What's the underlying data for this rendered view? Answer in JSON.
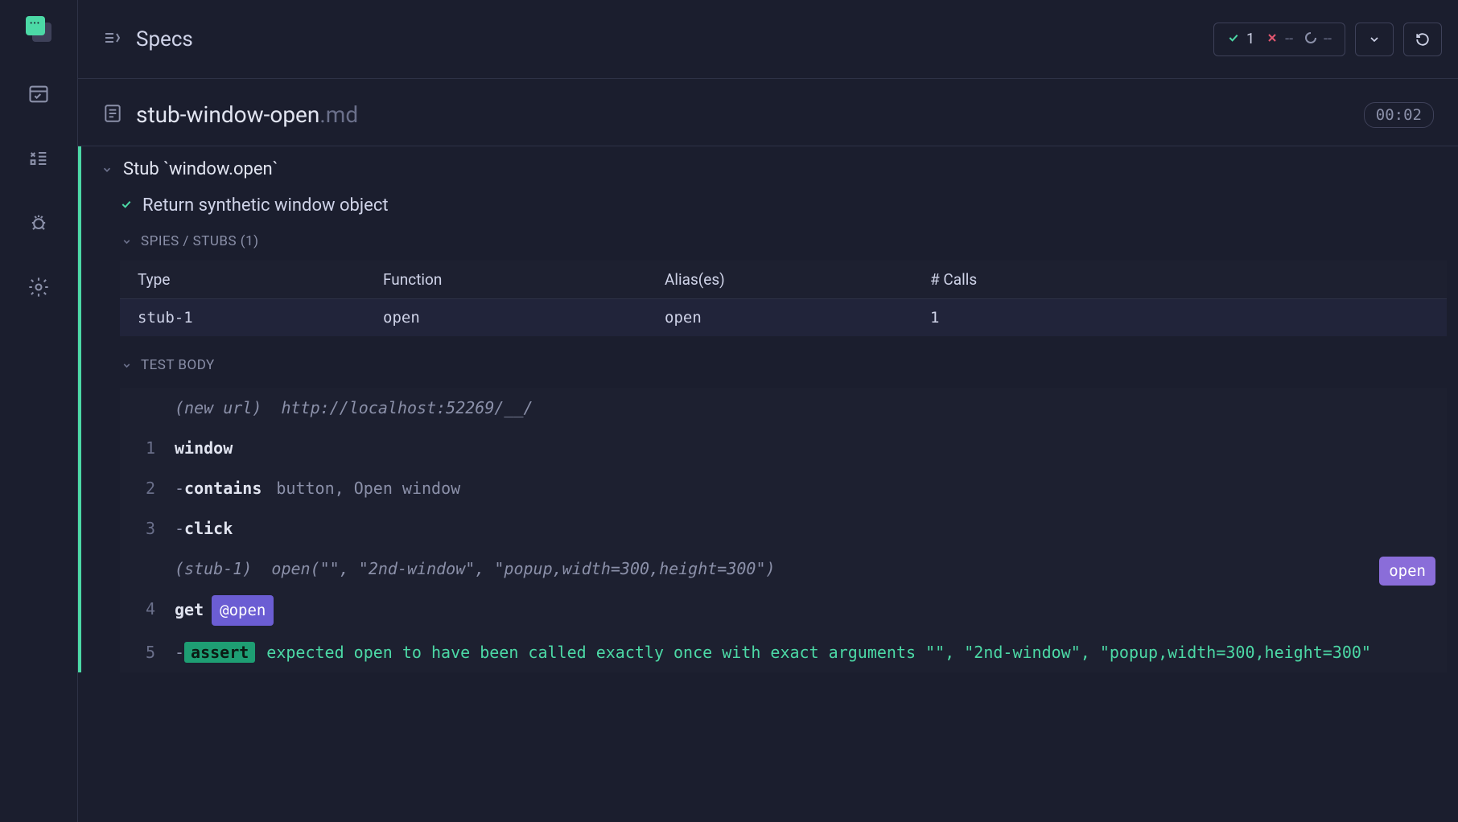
{
  "app": {
    "title": "Specs"
  },
  "stats": {
    "passed": "1",
    "failed": "--",
    "pending": "--"
  },
  "file": {
    "name": "stub-window-open",
    "ext": ".md",
    "timer": "00:02"
  },
  "suite": {
    "title": "Stub `window.open`"
  },
  "test": {
    "title": "Return synthetic window object"
  },
  "sections": {
    "spies": "SPIES / STUBS (1)",
    "body": "TEST BODY"
  },
  "stubs_table": {
    "headers": {
      "type": "Type",
      "func": "Function",
      "alias": "Alias(es)",
      "calls": "# Calls"
    },
    "row": {
      "type": "stub-1",
      "func": "open",
      "alias": "open",
      "calls": "1"
    }
  },
  "log": {
    "newurl_label": "(new url)",
    "newurl_val": "http://localhost:52269/__/",
    "r1_num": "1",
    "r1_cmd": "window",
    "r2_num": "2",
    "r2_cmd": "contains",
    "r2_args": "button, Open window",
    "r3_num": "3",
    "r3_cmd": "click",
    "stub_label": "(stub-1)",
    "stub_val": "open(\"\", \"2nd-window\", \"popup,width=300,height=300\")",
    "stub_pill": "open",
    "r4_num": "4",
    "r4_cmd": "get",
    "r4_alias": "@open",
    "r5_num": "5",
    "r5_cmd": "assert",
    "r5_text": "expected open to have been called exactly once with exact arguments \"\", \"2nd-window\", \"popup,width=300,height=300\""
  }
}
